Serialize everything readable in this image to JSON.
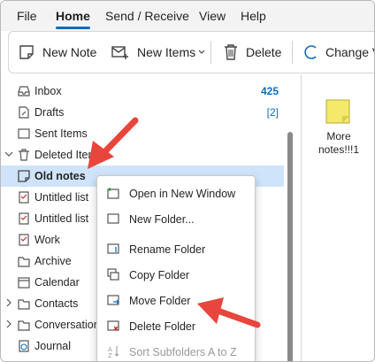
{
  "menu": {
    "items": [
      {
        "label": "File"
      },
      {
        "label": "Home"
      },
      {
        "label": "Send / Receive"
      },
      {
        "label": "View"
      },
      {
        "label": "Help"
      }
    ]
  },
  "ribbon": {
    "new_note": "New Note",
    "new_items": "New Items",
    "delete": "Delete",
    "change_view": "Change V"
  },
  "folders": [
    {
      "label": "Inbox",
      "count": "425",
      "icon": "inbox-icon"
    },
    {
      "label": "Drafts",
      "count": "[2]",
      "icon": "drafts-icon"
    },
    {
      "label": "Sent Items",
      "icon": "sent-icon"
    },
    {
      "label": "Deleted Items",
      "icon": "trash-icon"
    },
    {
      "label": "Old notes",
      "icon": "note-icon"
    },
    {
      "label": "Untitled list",
      "icon": "list-icon"
    },
    {
      "label": "Untitled list",
      "icon": "list-icon"
    },
    {
      "label": "Work",
      "icon": "list-icon"
    },
    {
      "label": "Archive",
      "icon": "archive-icon"
    },
    {
      "label": "Calendar",
      "icon": "calendar-icon"
    },
    {
      "label": "Contacts",
      "icon": "folder-icon"
    },
    {
      "label": "Conversation",
      "icon": "folder-icon"
    },
    {
      "label": "Journal",
      "icon": "journal-icon"
    }
  ],
  "content": {
    "note_title": "More notes!!!1"
  },
  "context_menu": [
    {
      "label": "Open in New Window",
      "icon": "open-window-icon"
    },
    {
      "label": "New Folder...",
      "icon": "new-folder-icon"
    },
    {
      "label": "Rename Folder",
      "icon": "rename-folder-icon"
    },
    {
      "label": "Copy Folder",
      "icon": "copy-folder-icon"
    },
    {
      "label": "Move Folder",
      "icon": "move-folder-icon"
    },
    {
      "label": "Delete Folder",
      "icon": "delete-folder-icon"
    },
    {
      "label": "Sort Subfolders A to Z",
      "icon": "sort-az-icon"
    }
  ],
  "colors": {
    "accent": "#0f6cbd",
    "selection": "#cfe4fa",
    "annotation_arrow": "#e8453c",
    "note_yellow": "#f5e96a"
  }
}
